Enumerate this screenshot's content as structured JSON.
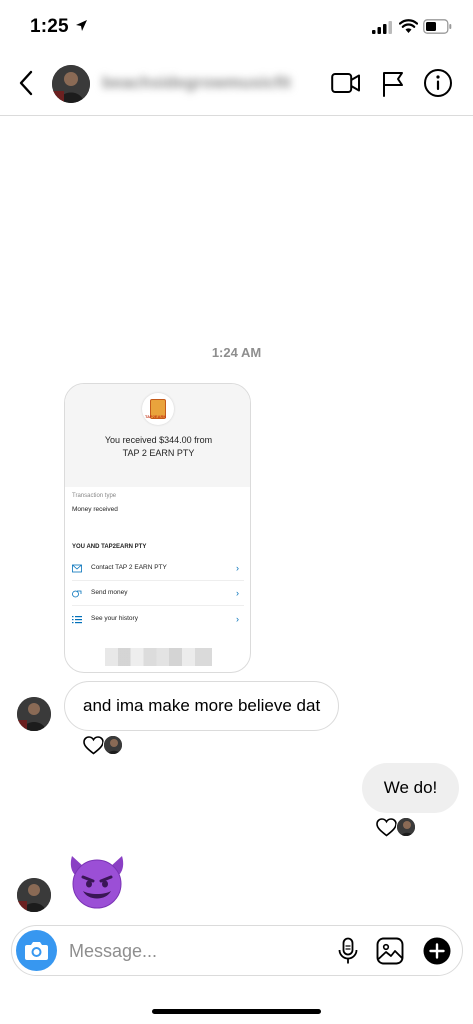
{
  "status_bar": {
    "time": "1:25",
    "icons": [
      "location-arrow-icon",
      "cellular-signal-icon",
      "wifi-icon",
      "battery-icon"
    ]
  },
  "header": {
    "contact_name": "beachsidegrowmusicfit",
    "icons": [
      "chevron-left-icon",
      "video-camera-icon",
      "flag-icon",
      "info-icon"
    ]
  },
  "conversation": {
    "timestamp": "1:24 AM",
    "shared_payment": {
      "received_text": "You received $344.00 from",
      "sender": "TAP 2 EARN PTY",
      "logo_text": "TAP2EARN",
      "transaction_type_label": "Transaction type",
      "transaction_type_value": "Money received",
      "section_title": "YOU AND TAP2EARN PTY",
      "rows": [
        {
          "label": "Contact TAP 2 EARN PTY",
          "icon": "mail-icon"
        },
        {
          "label": "Send money",
          "icon": "send-money-icon"
        },
        {
          "label": "See your history",
          "icon": "list-icon"
        }
      ]
    },
    "messages": [
      {
        "direction": "incoming",
        "text": "and ima make more believe dat"
      },
      {
        "direction": "outgoing",
        "text": "We do!"
      },
      {
        "direction": "incoming",
        "text": "😈"
      }
    ]
  },
  "composer": {
    "placeholder": "Message...",
    "icons": [
      "camera-icon",
      "microphone-icon",
      "gallery-icon",
      "plus-icon"
    ]
  },
  "colors": {
    "accent_blue": "#3797f0",
    "outgoing_bubble": "#efefef",
    "border": "#dbdbdb",
    "muted_text": "#8e8e8e",
    "paypal_blue": "#0070ba"
  }
}
